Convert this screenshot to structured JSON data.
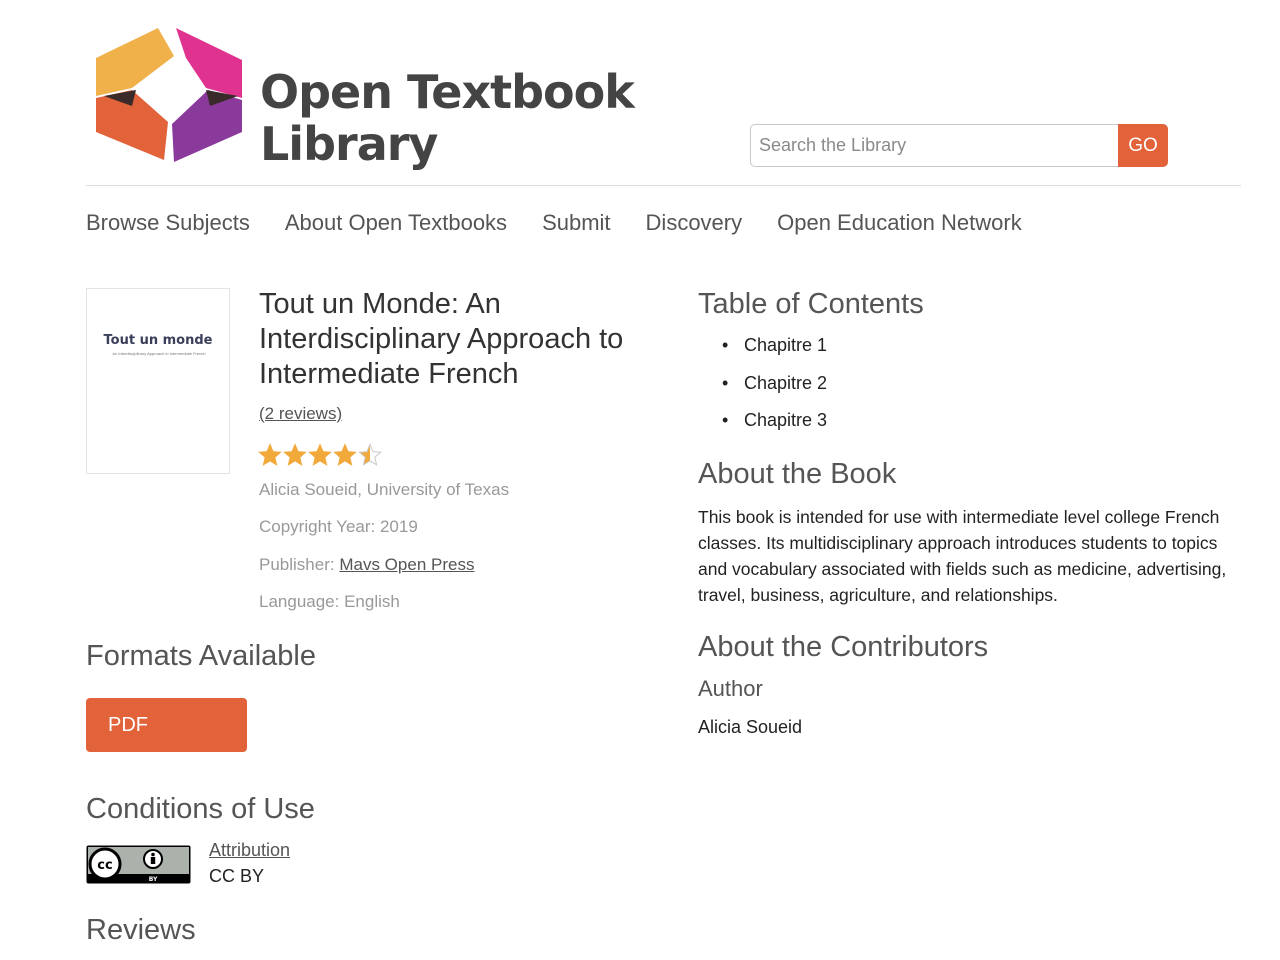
{
  "header": {
    "logo_line1": "Open Textbook",
    "logo_line2": "Library",
    "search_placeholder": "Search the Library",
    "search_button": "GO"
  },
  "nav": {
    "items": [
      {
        "label": "Browse Subjects"
      },
      {
        "label": "About Open Textbooks"
      },
      {
        "label": "Submit"
      },
      {
        "label": "Discovery"
      },
      {
        "label": "Open Education Network"
      }
    ]
  },
  "book": {
    "cover_title": "Tout un monde",
    "cover_subtitle": "An Interdisciplinary Approach to Intermediate French",
    "title": "Tout un Monde: An Interdisciplinary Approach to Intermediate French",
    "reviews_link": "(2 reviews)",
    "rating": 4.5,
    "rating_max": 5,
    "author_affiliation": "Alicia Soueid, University of Texas",
    "copyright": "Copyright Year: 2019",
    "publisher_label": "Publisher:",
    "publisher_name": "Mavs Open Press",
    "language": "Language: English"
  },
  "formats": {
    "heading": "Formats Available",
    "pdf_label": "PDF"
  },
  "conditions": {
    "heading": "Conditions of Use",
    "license_link": "Attribution",
    "license_name": "CC BY"
  },
  "reviews": {
    "heading": "Reviews"
  },
  "toc": {
    "heading": "Table of Contents",
    "items": [
      "Chapitre 1",
      "Chapitre 2",
      "Chapitre 3"
    ]
  },
  "about_book": {
    "heading": "About the Book",
    "text": "This book is intended for use with intermediate level college French classes. Its multidisciplinary approach introduces students to topics and vocabulary associated with fields such as medicine, advertising, travel, business, agriculture, and relationships."
  },
  "contributors": {
    "heading": "About the Contributors",
    "role": "Author",
    "name": "Alicia Soueid"
  },
  "colors": {
    "accent": "#e2623a",
    "star": "#f2a93b",
    "logo_yellow": "#f0b04a",
    "logo_magenta": "#e0338f",
    "logo_orange": "#e2623a",
    "logo_purple": "#8a3a9b"
  }
}
